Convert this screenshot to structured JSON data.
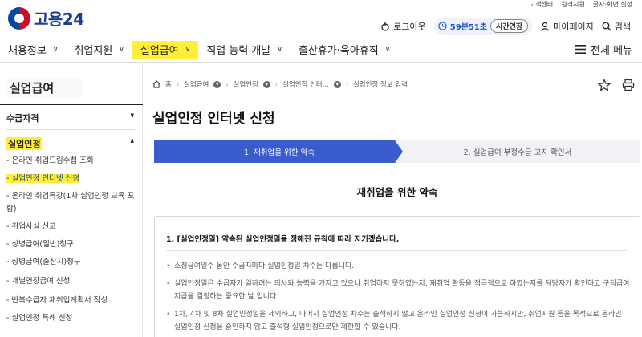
{
  "util": [
    "고객센터",
    "원격지원",
    "글자·화면 설정"
  ],
  "logo": {
    "text": "고용24"
  },
  "header": {
    "logout": "로그아웃",
    "timer": "59분51초",
    "extend": "시간연장",
    "mypage": "마이페이지",
    "search": "검색"
  },
  "gnb": {
    "items": [
      {
        "label": "채용정보"
      },
      {
        "label": "취업지원"
      },
      {
        "label": "실업급여"
      },
      {
        "label": "직업 능력 개발"
      },
      {
        "label": "출산휴가·육아휴직"
      }
    ],
    "all_menu": "전체 메뉴"
  },
  "sidebar": {
    "title": "실업급여",
    "sections": [
      {
        "label": "수급자격"
      },
      {
        "label": "실업인정"
      }
    ],
    "subitems": [
      "- 온라인 취업드림수첩 조회",
      "- 실업인정 인터넷 신청",
      "- 온라인 취업특강(1차 실업인정 교육 포함)",
      "- 취업사실 신고",
      "- 상병급여(일반)청구",
      "- 상병급여(출산시)청구",
      "- 개별연장급여 신청",
      "- 반복수급자 재취업계획서 작성",
      "- 실업인정 특례 신청"
    ]
  },
  "breadcrumb": [
    "홈",
    "실업급여",
    "실업인정",
    "실업인정 인터...",
    "실업인정 정보 입력"
  ],
  "page_title": "실업인정 인터넷 신청",
  "steps": [
    "1. 재취업을 위한 약속",
    "2. 실업급여 부정수급 고지 확인서"
  ],
  "section_title": "재취업을 위한 약속",
  "box": {
    "heading": "1. [실업인정일] 약속된 실업인정일을 정해진 규칙에 따라 지키겠습니다.",
    "bullets": [
      "소정급여일수 동안 수급자마다 실업인정일 차수는 다릅니다.",
      "실업인정일은 수급자가 일하려는 의사와 능력을 가지고 있으나 취업하지 못하였는지, 재취업 활동을 적극적으로 하였는지를 담당자가 확인하고 구직급여 지급을 결정하는 중요한 날 입니다.",
      "1차, 4차 및 8차 실업인정일을 제외하고, 나머지 실업인정 차수는 출석하지 않고 온라인 실업인정 신청이 가능하지만, 취업지원 등을 목적으로 온라인 실업인정 신청을 승인하지 않고 출석형 실업인정으로만 제한할 수 있습니다."
    ]
  },
  "colors": {
    "accent": "#3a5ccc",
    "highlight": "#ffef3a",
    "brand": "#1a3f8b"
  }
}
